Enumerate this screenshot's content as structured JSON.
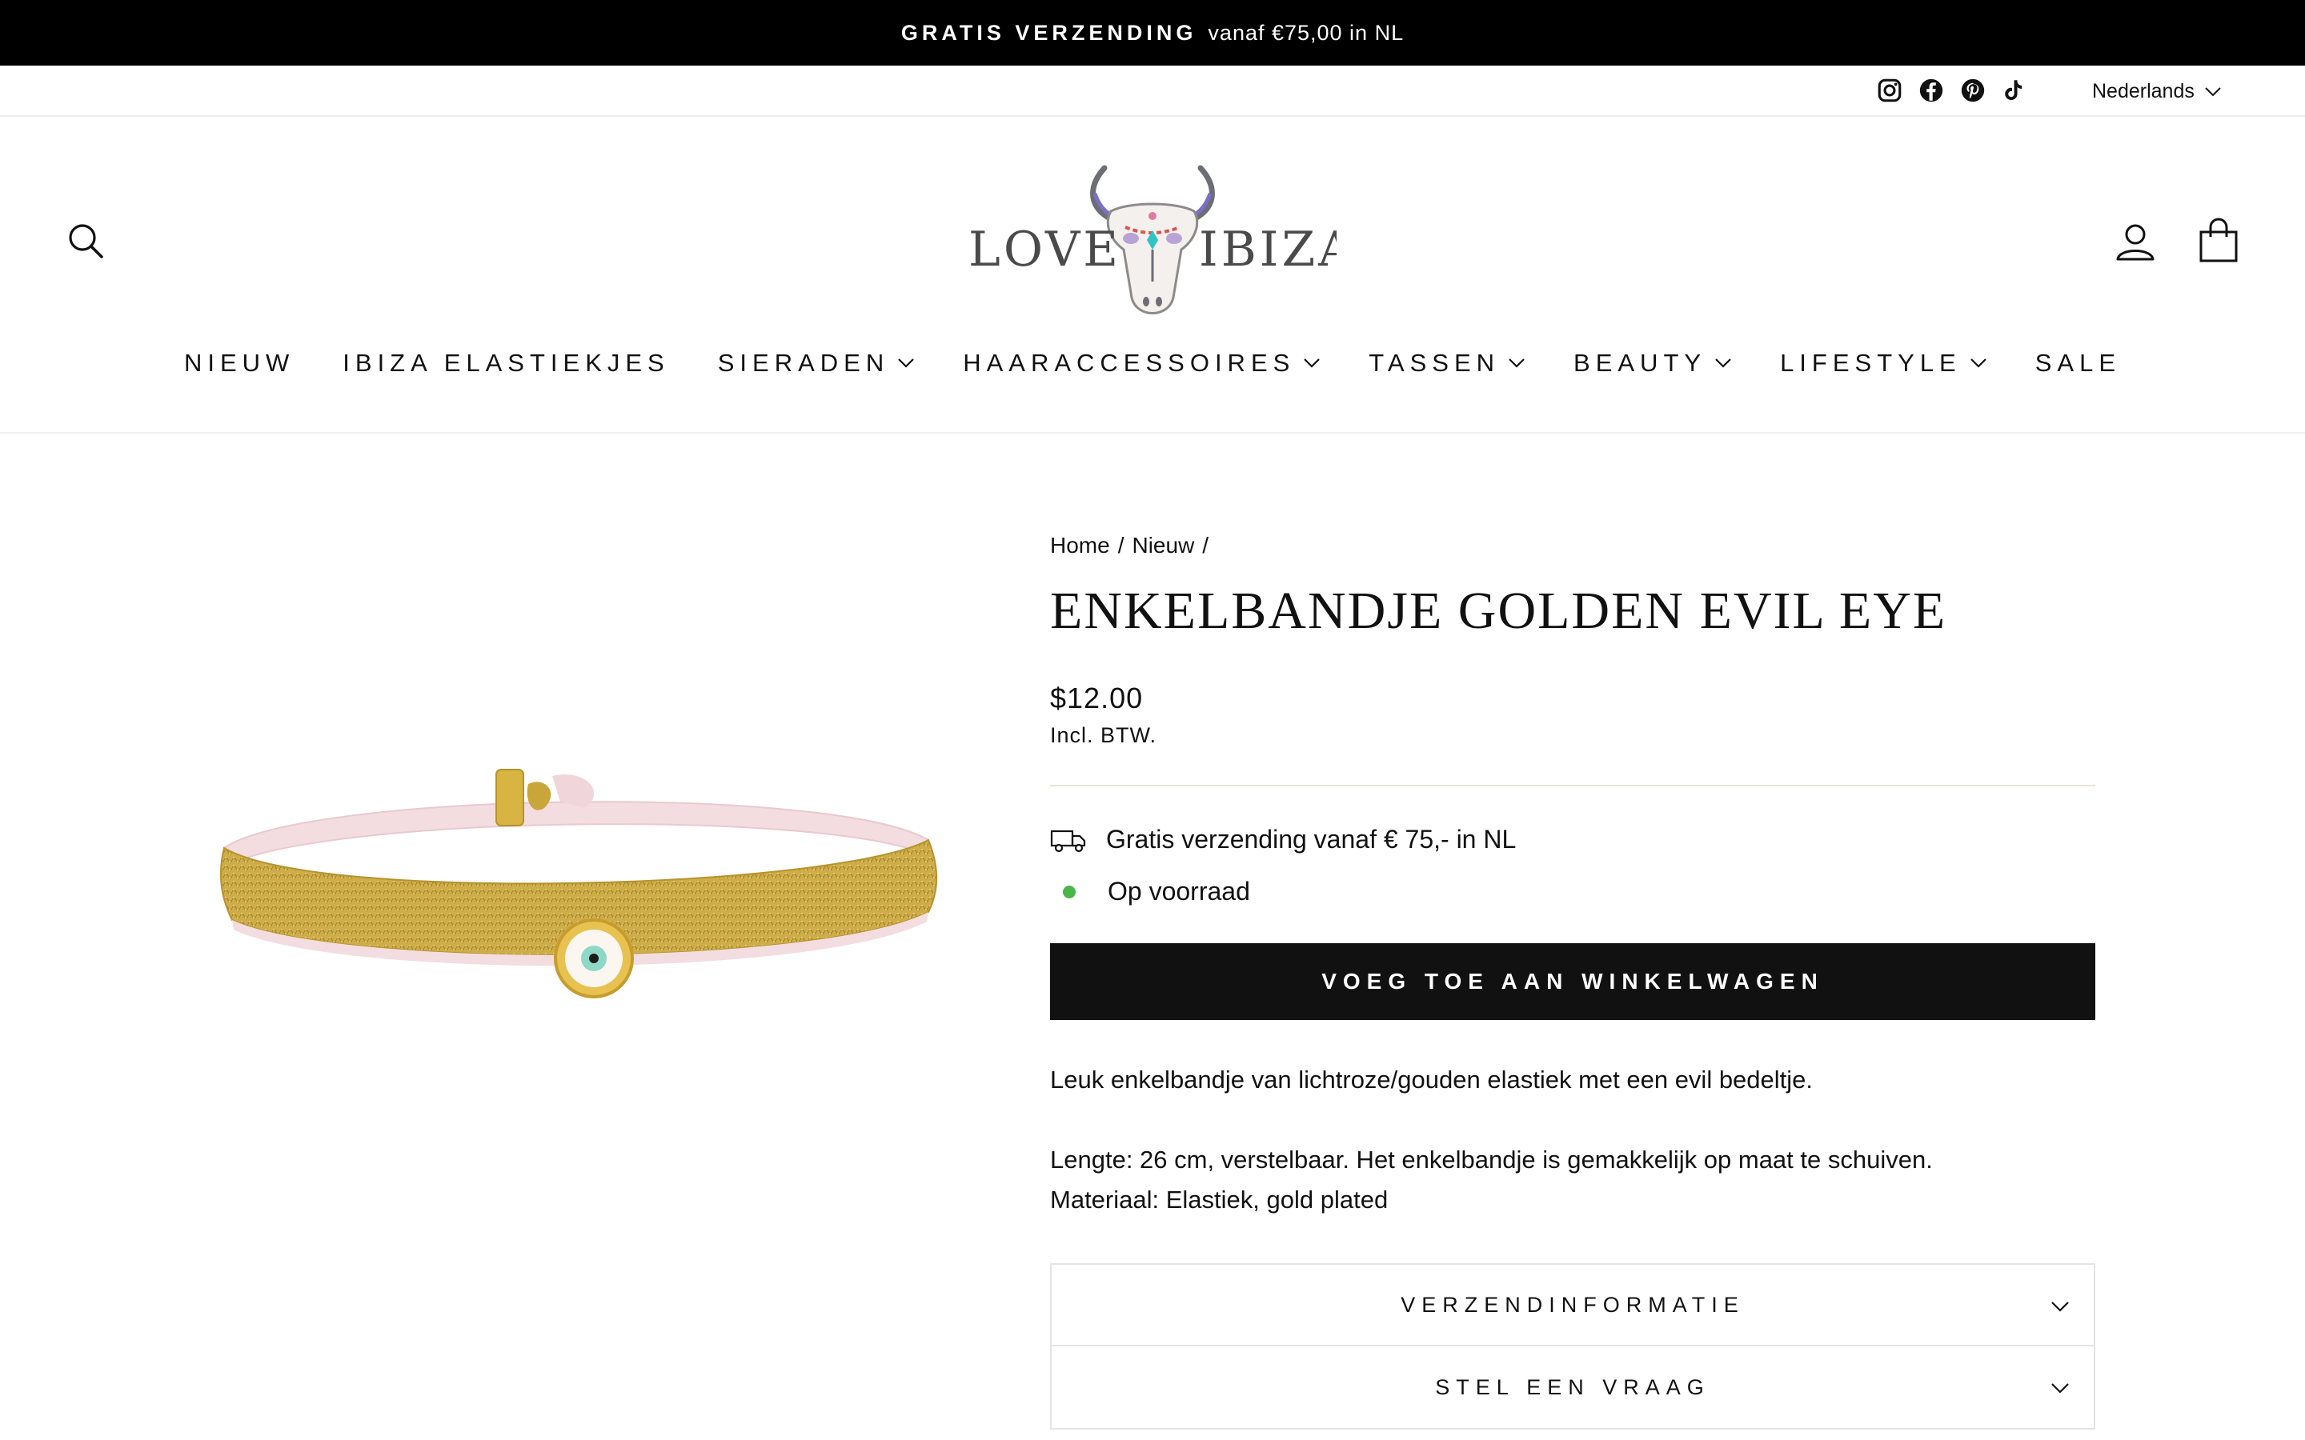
{
  "announcement": {
    "bold": "GRATIS VERZENDING",
    "rest": "vanaf €75,00 in NL"
  },
  "utility": {
    "social": [
      "instagram-icon",
      "facebook-icon",
      "pinterest-icon",
      "tiktok-icon"
    ],
    "language": "Nederlands"
  },
  "header": {
    "logo_alt": "LOVE IBIZA",
    "logo_left": "LOVE",
    "logo_right": "IBIZA",
    "nav": [
      {
        "label": "NIEUW",
        "dropdown": false
      },
      {
        "label": "IBIZA ELASTIEKJES",
        "dropdown": false
      },
      {
        "label": "SIERADEN",
        "dropdown": true
      },
      {
        "label": "HAARACCESSOIRES",
        "dropdown": true
      },
      {
        "label": "TASSEN",
        "dropdown": true
      },
      {
        "label": "BEAUTY",
        "dropdown": true
      },
      {
        "label": "LIFESTYLE",
        "dropdown": true
      },
      {
        "label": "SALE",
        "dropdown": false
      }
    ]
  },
  "product": {
    "breadcrumb": [
      "Home",
      "/",
      "Nieuw",
      "/"
    ],
    "title": "ENKELBANDJE GOLDEN EVIL EYE",
    "price": "$12.00",
    "tax_note": "Incl. BTW.",
    "shipping_note": "Gratis verzending vanaf € 75,- in NL",
    "stock": "Op voorraad",
    "add_to_cart": "VOEG TOE AAN WINKELWAGEN",
    "description": [
      "Leuk enkelbandje van lichtroze/gouden elastiek met een evil bedeltje.",
      "Lengte: 26 cm, verstelbaar. Het enkelbandje is gemakkelijk op maat te schuiven.",
      "Materiaal: Elastiek, gold plated"
    ],
    "accordions": [
      "VERZENDINFORMATIE",
      "STEL EEN VRAAG"
    ]
  },
  "colors": {
    "announcement_bg": "#000000",
    "button_bg": "#111111",
    "stock_dot": "#4ab54a",
    "gold": "#c9a63a",
    "pink": "#f3dde0"
  }
}
